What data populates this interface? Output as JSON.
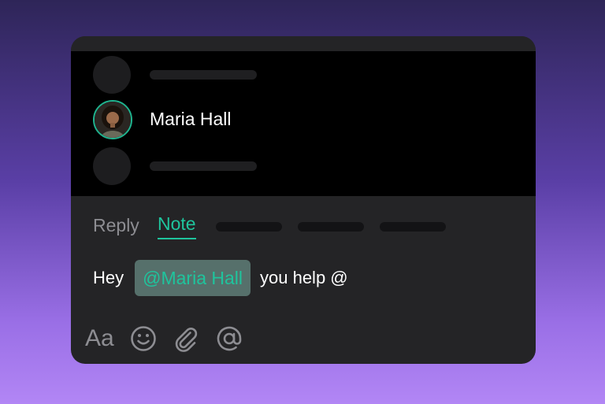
{
  "mention_list": {
    "selected_user": {
      "name": "Maria Hall",
      "avatar_icon": "person-avatar"
    }
  },
  "tabs": {
    "reply_label": "Reply",
    "note_label": "Note",
    "active": "Note"
  },
  "composer": {
    "text_before": "Hey",
    "mention": "@Maria Hall",
    "text_after": "you help @"
  },
  "toolbar": {
    "format_label": "Aa",
    "icons": [
      "format-text-icon",
      "emoji-icon",
      "attachment-icon",
      "mention-icon"
    ]
  },
  "colors": {
    "accent": "#1fc49d",
    "card_bg": "#242426",
    "list_bg": "#000000",
    "muted_text": "#8d8d92",
    "mention_chip_bg": "#56706b"
  }
}
